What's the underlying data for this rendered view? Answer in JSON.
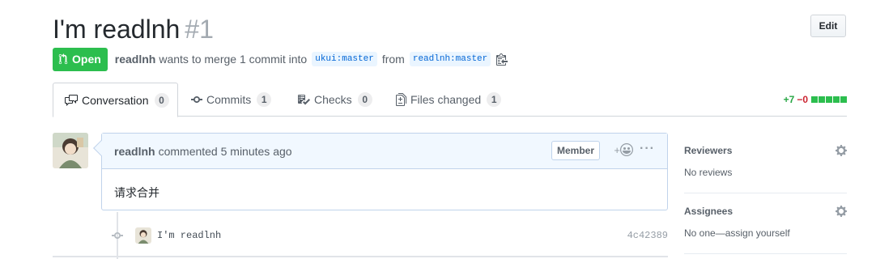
{
  "pr": {
    "title": "I'm readlnh",
    "number": "#1",
    "edit_label": "Edit",
    "state": "Open",
    "author": "readlnh",
    "merge_text_1": "wants to merge 1 commit into",
    "base_branch": "ukui:master",
    "merge_text_2": "from",
    "head_branch": "readlnh:master"
  },
  "tabs": [
    {
      "label": "Conversation",
      "count": "0",
      "icon": "comment-discussion-icon"
    },
    {
      "label": "Commits",
      "count": "1",
      "icon": "git-commit-icon"
    },
    {
      "label": "Checks",
      "count": "0",
      "icon": "checklist-icon"
    },
    {
      "label": "Files changed",
      "count": "1",
      "icon": "file-diff-icon"
    }
  ],
  "diffstat": {
    "additions": "+7",
    "deletions": "−0"
  },
  "comment": {
    "author": "readlnh",
    "action_text": "commented 5 minutes ago",
    "role_label": "Member",
    "reaction_icon": "smiley-icon",
    "more_label": "···",
    "body": "请求合并"
  },
  "commit": {
    "message": "I'm readlnh",
    "sha": "4c42389"
  },
  "sidebar": {
    "reviewers": {
      "heading": "Reviewers",
      "value": "No reviews"
    },
    "assignees": {
      "heading": "Assignees",
      "value": "No one—assign yourself"
    }
  },
  "colors": {
    "open_green": "#2cbe4e",
    "link_blue": "#0366d6",
    "comment_header_bg": "#f1f8ff",
    "deletion_red": "#cb2431"
  }
}
